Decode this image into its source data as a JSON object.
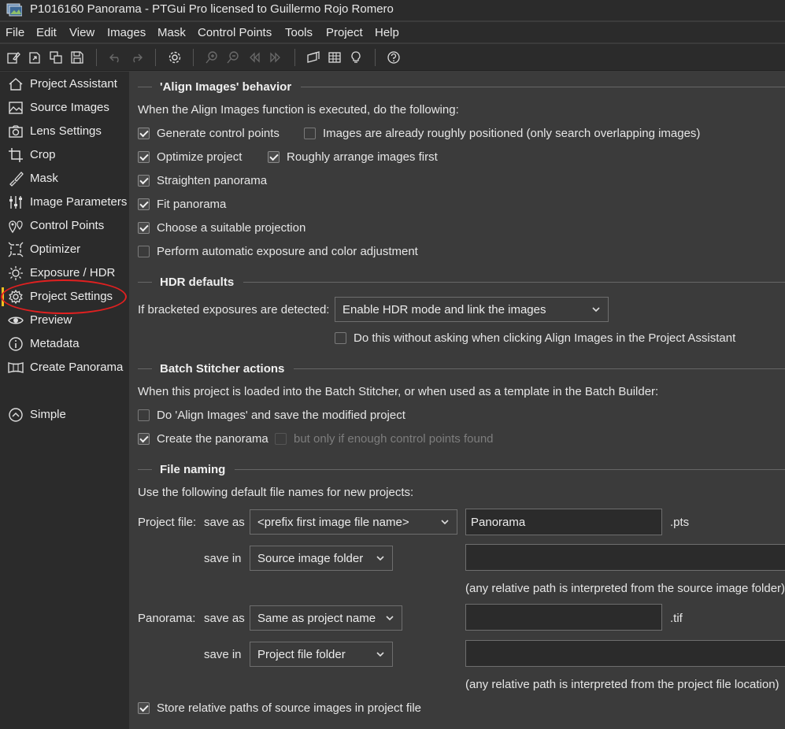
{
  "window": {
    "title": "P1016160 Panorama - PTGui Pro licensed to Guillermo Rojo Romero"
  },
  "menu": [
    "File",
    "Edit",
    "View",
    "Images",
    "Mask",
    "Control Points",
    "Tools",
    "Project",
    "Help"
  ],
  "toolbar": {
    "icons": [
      "new-project-icon",
      "open-project-icon",
      "copy-icon",
      "save-icon",
      "undo-icon",
      "redo-icon",
      "settings-icon",
      "zoom-in-icon",
      "zoom-out-icon",
      "previous-icon",
      "next-icon",
      "panorama-editor-icon",
      "table-icon",
      "lightbulb-icon",
      "help-icon"
    ]
  },
  "sidebar": {
    "items": [
      {
        "label": "Project Assistant",
        "icon": "home-icon"
      },
      {
        "label": "Source Images",
        "icon": "image-icon"
      },
      {
        "label": "Lens Settings",
        "icon": "camera-icon"
      },
      {
        "label": "Crop",
        "icon": "crop-icon"
      },
      {
        "label": "Mask",
        "icon": "brush-icon"
      },
      {
        "label": "Image Parameters",
        "icon": "sliders-icon"
      },
      {
        "label": "Control Points",
        "icon": "pins-icon"
      },
      {
        "label": "Optimizer",
        "icon": "optimizer-icon"
      },
      {
        "label": "Exposure / HDR",
        "icon": "sun-icon"
      },
      {
        "label": "Project Settings",
        "icon": "gear-icon"
      },
      {
        "label": "Preview",
        "icon": "eye-icon"
      },
      {
        "label": "Metadata",
        "icon": "info-icon"
      },
      {
        "label": "Create Panorama",
        "icon": "panorama-icon"
      }
    ],
    "active": "Project Settings",
    "simple": {
      "label": "Simple",
      "icon": "chevron-up-icon"
    },
    "highlight_color": "#e02020",
    "active_marker_color": "#f0c020"
  },
  "align": {
    "heading": "'Align Images' behavior",
    "intro": "When the Align Images function is executed, do the following:",
    "generate_cp": {
      "label": "Generate control points",
      "checked": true
    },
    "roughly_positioned": {
      "label": "Images are already roughly positioned (only search overlapping images)",
      "checked": false
    },
    "optimize": {
      "label": "Optimize project",
      "checked": true
    },
    "roughly_arrange": {
      "label": "Roughly arrange images first",
      "checked": true
    },
    "straighten": {
      "label": "Straighten panorama",
      "checked": true
    },
    "fit": {
      "label": "Fit panorama",
      "checked": true
    },
    "projection": {
      "label": "Choose a suitable projection",
      "checked": true
    },
    "exposure": {
      "label": "Perform automatic exposure and color adjustment",
      "checked": false
    }
  },
  "hdr": {
    "heading": "HDR defaults",
    "label": "If bracketed exposures are detected:",
    "selected": "Enable HDR mode and link the images",
    "no_ask": {
      "label": "Do this without asking when clicking Align Images in the Project Assistant",
      "checked": false
    }
  },
  "batch": {
    "heading": "Batch Stitcher actions",
    "intro": "When this project is loaded into the Batch Stitcher, or when used as a template in the Batch Builder:",
    "align_save": {
      "label": "Do 'Align Images' and save the modified project",
      "checked": false
    },
    "create": {
      "label": "Create the panorama",
      "checked": true
    },
    "only_if": {
      "label": "but only if enough control points found",
      "checked": false,
      "disabled": true
    }
  },
  "naming": {
    "heading": "File naming",
    "intro": "Use the following default file names for new projects:",
    "project_label": "Project file:",
    "save_as": "save as",
    "save_in": "save in",
    "project_save_as": "<prefix first image file name>",
    "project_name_value": "Panorama",
    "project_ext": ".pts",
    "project_save_in": "Source image folder",
    "project_path_value": "",
    "project_note": "(any relative path is interpreted from the source image folder)",
    "panorama_label": "Panorama:",
    "panorama_save_as": "Same as project name",
    "panorama_name_value": "",
    "panorama_ext": ".tif",
    "panorama_save_in": "Project file folder",
    "panorama_path_value": "",
    "panorama_note": "(any relative path is interpreted from the project file location)",
    "relative": {
      "label": "Store relative paths of source images in project file",
      "checked": true
    }
  }
}
